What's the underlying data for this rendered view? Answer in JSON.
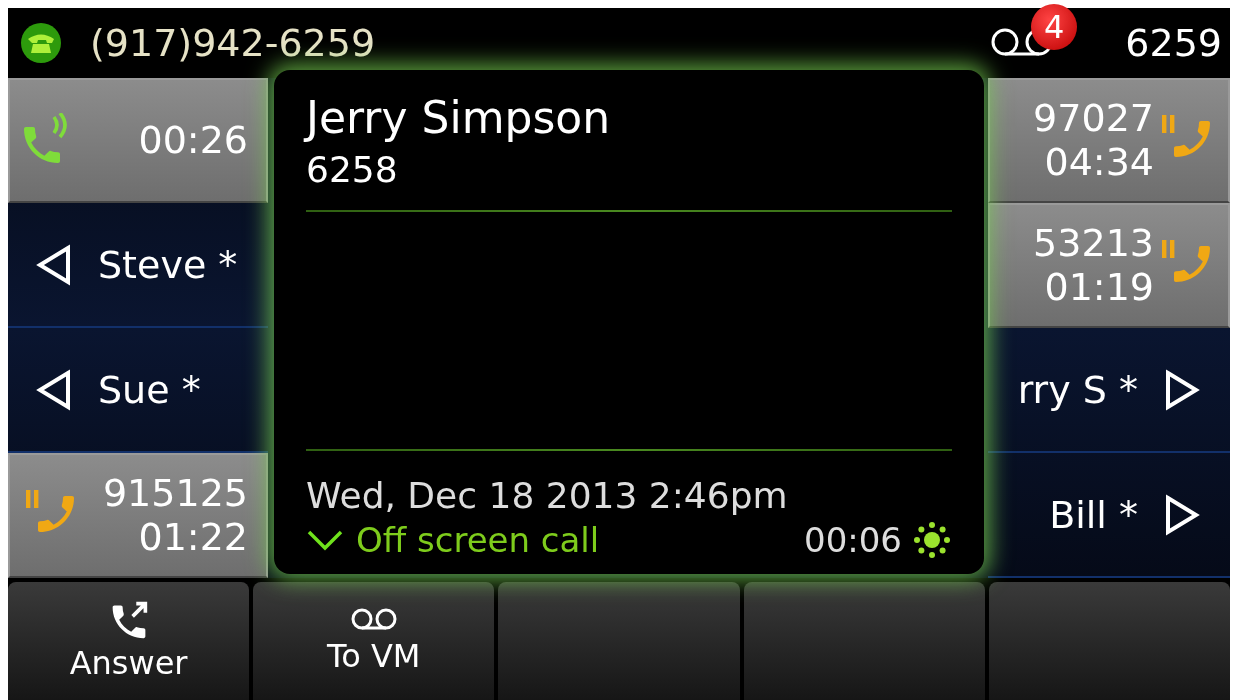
{
  "status_bar": {
    "phone_number": "(917)942-6259",
    "voicemail_count": "4",
    "extension": "6259"
  },
  "left_keys": [
    {
      "kind": "call",
      "on_hold": false,
      "time": "00:26"
    },
    {
      "kind": "contact",
      "name": "Steve *"
    },
    {
      "kind": "contact",
      "name": "Sue *"
    },
    {
      "kind": "call",
      "on_hold": true,
      "number": "915125",
      "time": "01:22"
    }
  ],
  "right_keys": [
    {
      "kind": "call",
      "on_hold": true,
      "number": "97027",
      "time": "04:34"
    },
    {
      "kind": "call",
      "on_hold": true,
      "number": "53213",
      "time": "01:19"
    },
    {
      "kind": "contact",
      "name": "rry S *"
    },
    {
      "kind": "contact",
      "name": "Bill *"
    }
  ],
  "incoming_call": {
    "caller_name": "Jerry Simpson",
    "caller_number": "6258",
    "datetime": "Wed, Dec 18 2013 2:46pm",
    "label": "Off screen call",
    "duration": "00:06"
  },
  "softkeys": [
    {
      "kind": "answer",
      "label": "Answer"
    },
    {
      "kind": "voicemail",
      "label": "To VM"
    },
    {
      "kind": "empty"
    },
    {
      "kind": "empty"
    },
    {
      "kind": "empty"
    }
  ]
}
